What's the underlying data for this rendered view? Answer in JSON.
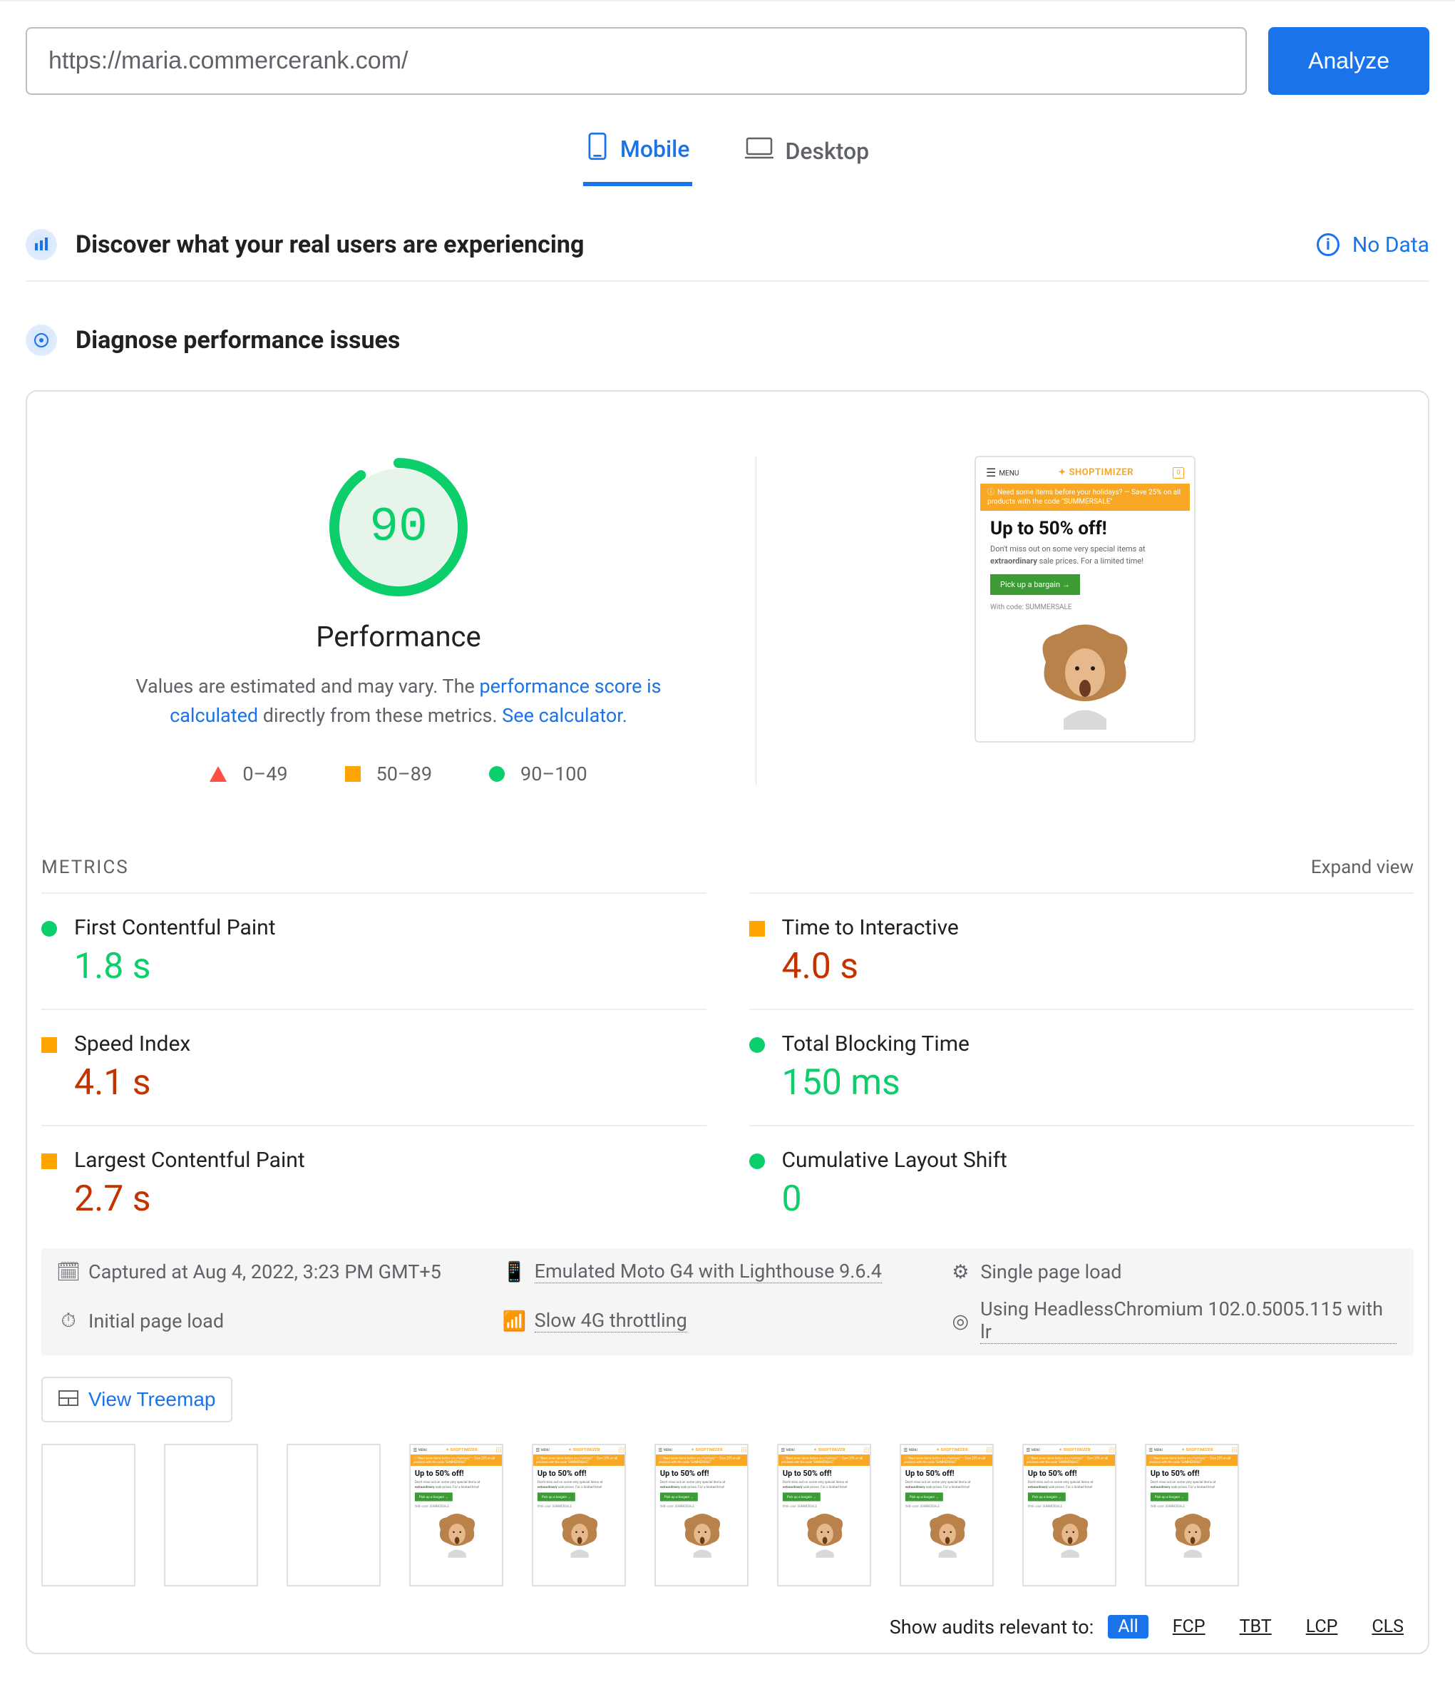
{
  "topbar": {
    "url_value": "https://maria.commercerank.com/",
    "analyze_label": "Analyze"
  },
  "device_tabs": {
    "mobile": "Mobile",
    "desktop": "Desktop"
  },
  "discover": {
    "title": "Discover what your real users are experiencing",
    "no_data": "No Data"
  },
  "diagnose": {
    "title": "Diagnose performance issues"
  },
  "performance": {
    "score": "90",
    "label": "Performance",
    "desc_prefix": "Values are estimated and may vary. The ",
    "desc_link1": "performance score is calculated",
    "desc_middle": " directly from these metrics. ",
    "desc_link2": "See calculator.",
    "legend": {
      "poor": "0–49",
      "avg": "50–89",
      "good": "90–100"
    }
  },
  "phone_mock": {
    "menu": "MENU",
    "brand": "SHOPTIMIZER",
    "banner": "Need some items before your holidays? — Save 25% on all products with the code \"SUMMERSALE\"",
    "hero_title": "Up to 50% off!",
    "hero_p1": "Don't miss out on some very special items at ",
    "hero_strong": "extraordinary",
    "hero_p2": " sale prices. For a limited time!",
    "cta": "Pick up a bargain →",
    "code": "With code: SUMMERSALE"
  },
  "metrics_header": {
    "label": "METRICS",
    "expand": "Expand view"
  },
  "metrics": {
    "fcp": {
      "name": "First Contentful Paint",
      "value": "1.8 s",
      "status": "good"
    },
    "tti": {
      "name": "Time to Interactive",
      "value": "4.0 s",
      "status": "avg"
    },
    "si": {
      "name": "Speed Index",
      "value": "4.1 s",
      "status": "avg"
    },
    "tbt": {
      "name": "Total Blocking Time",
      "value": "150 ms",
      "status": "good"
    },
    "lcp": {
      "name": "Largest Contentful Paint",
      "value": "2.7 s",
      "status": "avg"
    },
    "cls": {
      "name": "Cumulative Layout Shift",
      "value": "0",
      "status": "good"
    }
  },
  "env": {
    "captured": "Captured at Aug 4, 2022, 3:23 PM GMT+5",
    "emulated": "Emulated Moto G4 with Lighthouse 9.6.4",
    "single": "Single page load",
    "initial": "Initial page load",
    "throttle": "Slow 4G throttling",
    "chrome": "Using HeadlessChromium 102.0.5005.115 with lr"
  },
  "treemap": {
    "label": "View Treemap"
  },
  "audits": {
    "prompt": "Show audits relevant to:",
    "all": "All",
    "fcp": "FCP",
    "tbt": "TBT",
    "lcp": "LCP",
    "cls": "CLS"
  }
}
